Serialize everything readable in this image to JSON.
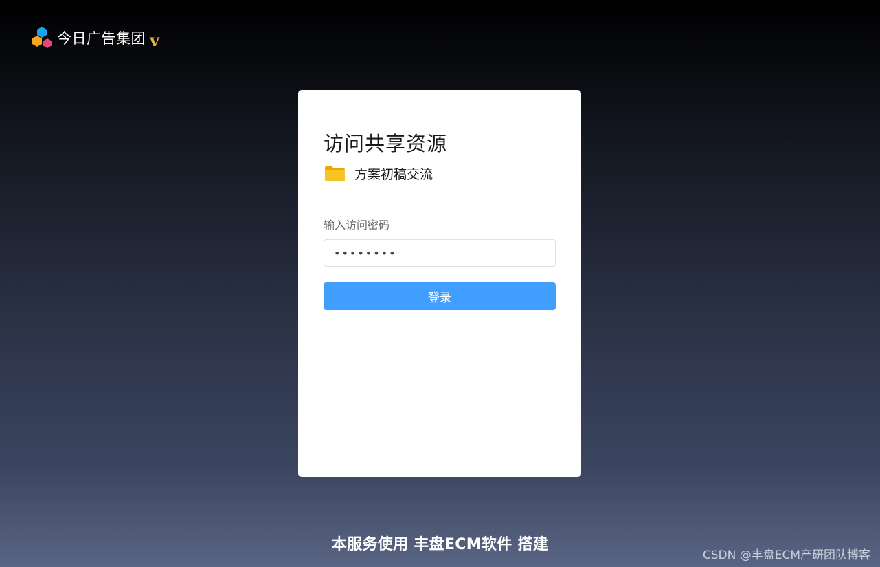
{
  "brand": {
    "name": "今日广告集团",
    "badge": "v",
    "logo_icon": "hexagon-cluster-logo",
    "colors": {
      "blue": "#1aa3e8",
      "orange": "#f5a623",
      "pink": "#e8457a",
      "badge": "#e8b04c"
    }
  },
  "card": {
    "title": "访问共享资源",
    "share": {
      "icon": "folder-icon",
      "name": "方案初稿交流",
      "icon_color": "#f7c325"
    },
    "password": {
      "label": "输入访问密码",
      "value": "••••••••"
    },
    "login_button": {
      "label": "登录",
      "color": "#409eff"
    }
  },
  "footer": {
    "text": "本服务使用 丰盘ECM软件 搭建"
  },
  "watermark": {
    "text": "CSDN @丰盘ECM产研团队博客"
  }
}
